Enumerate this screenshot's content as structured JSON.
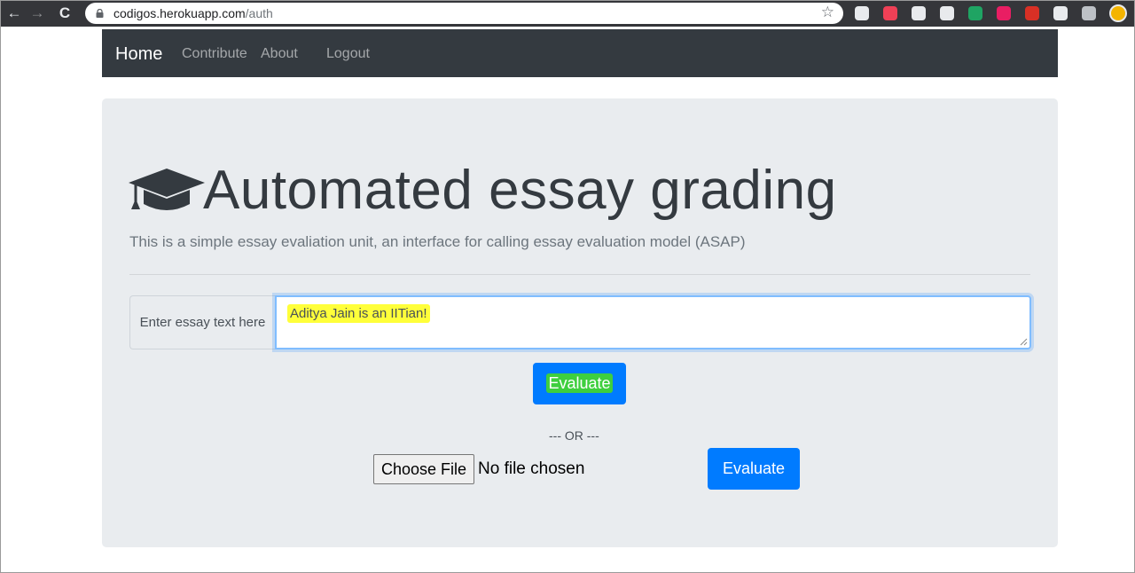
{
  "browser": {
    "url_host": "codigos.herokuapp.com",
    "url_path": "/auth",
    "nav": {
      "back": "←",
      "forward": "→",
      "reload": "C"
    },
    "star": "☆",
    "extensions": [
      {
        "name": "speed-dial-extension-icon",
        "color": "#e8eaed"
      },
      {
        "name": "pocket-extension-icon",
        "color": "#ef4056"
      },
      {
        "name": "arrow-extension-icon",
        "color": "#e8eaed"
      },
      {
        "name": "bulb-extension-icon",
        "color": "#e8eaed"
      },
      {
        "name": "google-drive-extension-icon",
        "color": "#1fa463"
      },
      {
        "name": "video-extension-icon",
        "color": "#e91e63"
      },
      {
        "name": "adblock-extension-icon",
        "color": "#d93025"
      },
      {
        "name": "printer-extension-icon",
        "color": "#e8eaed"
      },
      {
        "name": "cloud-extension-icon",
        "color": "#bdc1c6"
      }
    ]
  },
  "navbar": {
    "brand": "Home",
    "links": [
      "Contribute",
      "About",
      "Logout"
    ]
  },
  "main": {
    "icon": "graduation-cap-icon",
    "title": "Automated essay grading",
    "lead": "This is a simple essay evaliation unit, an interface for calling essay evaluation model (ASAP)",
    "input_label": "Enter essay text here",
    "essay_value": "Aditya Jain is an IITian!",
    "evaluate_button": "Evaluate",
    "or_text": "--- OR ---",
    "file_button": "Choose File",
    "file_status": "No file chosen",
    "evaluate_file_button": "Evaluate"
  },
  "colors": {
    "navbar_bg": "#343a40",
    "primary": "#007bff",
    "jumbotron_bg": "#e9ecef",
    "text_highlight": "#ffff3a",
    "button_highlight": "#3ecf3e"
  }
}
